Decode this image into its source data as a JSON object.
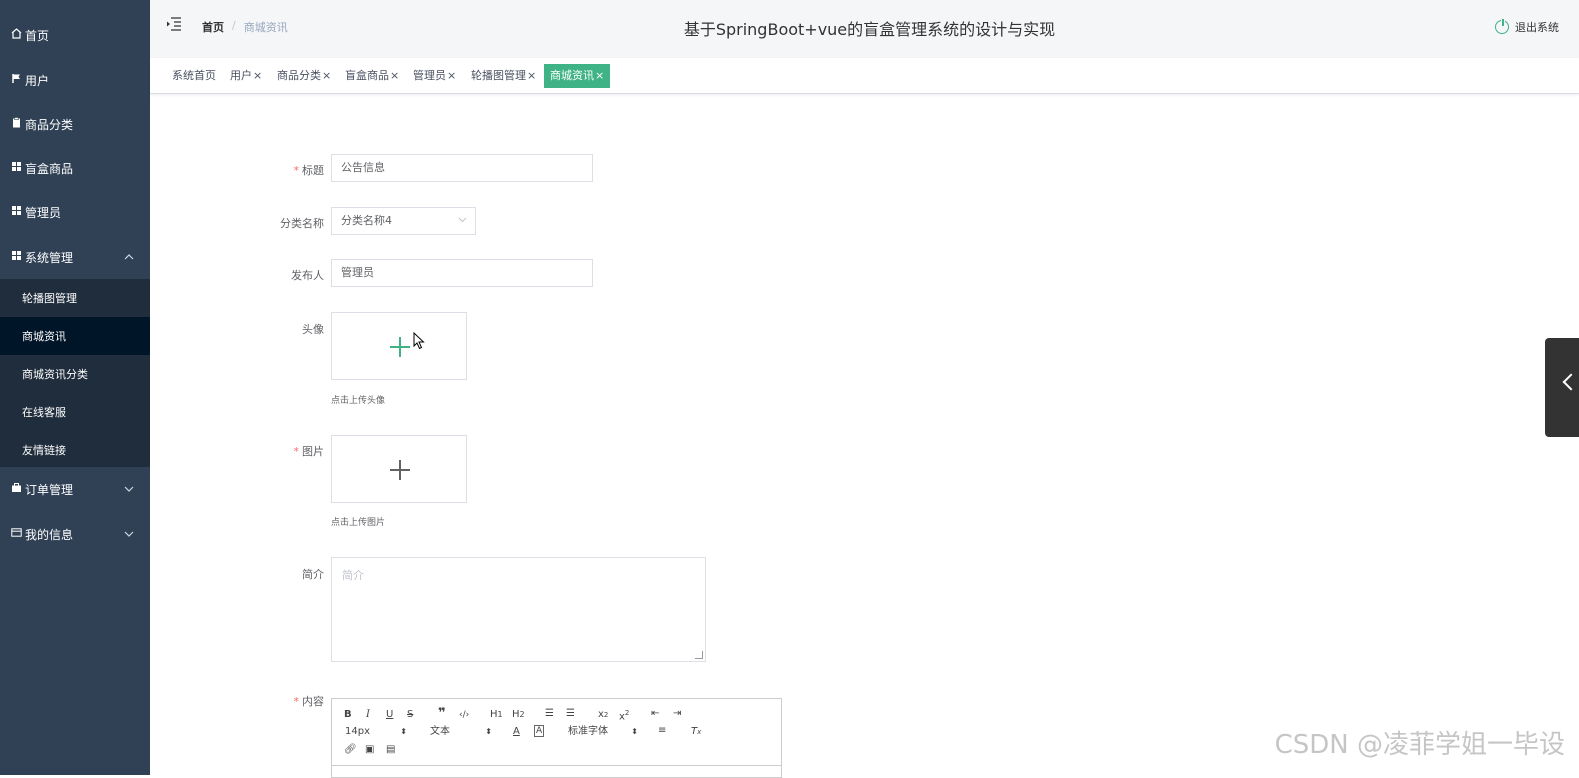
{
  "sidebar": {
    "items": [
      {
        "label": "首页",
        "icon": "home-icon"
      },
      {
        "label": "用户",
        "icon": "flag-icon"
      },
      {
        "label": "商品分类",
        "icon": "clipboard-icon"
      },
      {
        "label": "盲盒商品",
        "icon": "grid-icon"
      },
      {
        "label": "管理员",
        "icon": "grid-icon"
      },
      {
        "label": "系统管理",
        "icon": "grid-icon",
        "expanded": true
      }
    ],
    "sub_items": [
      {
        "label": "轮播图管理"
      },
      {
        "label": "商城资讯",
        "active": true
      },
      {
        "label": "商城资讯分类"
      },
      {
        "label": "在线客服"
      },
      {
        "label": "友情链接"
      }
    ],
    "bottom_items": [
      {
        "label": "订单管理",
        "icon": "briefcase-icon"
      },
      {
        "label": "我的信息",
        "icon": "card-icon"
      }
    ]
  },
  "header": {
    "breadcrumb_home": "首页",
    "breadcrumb_sep": "/",
    "breadcrumb_current": "商城资讯",
    "title": "基于SpringBoot+vue的盲盒管理系统的设计与实现",
    "logout": "退出系统"
  },
  "tags": [
    {
      "label": "系统首页",
      "closable": false
    },
    {
      "label": "用户",
      "closable": true
    },
    {
      "label": "商品分类",
      "closable": true
    },
    {
      "label": "盲盒商品",
      "closable": true
    },
    {
      "label": "管理员",
      "closable": true
    },
    {
      "label": "轮播图管理",
      "closable": true
    },
    {
      "label": "商城资讯",
      "closable": true,
      "active": true
    }
  ],
  "tag_close": "×",
  "form": {
    "title_label": "标题",
    "title_value": "公告信息",
    "category_label": "分类名称",
    "category_value": "分类名称4",
    "publisher_label": "发布人",
    "publisher_value": "管理员",
    "avatar_label": "头像",
    "avatar_hint": "点击上传头像",
    "image_label": "图片",
    "image_hint": "点击上传图片",
    "intro_label": "简介",
    "intro_placeholder": "简介",
    "content_label": "内容",
    "required_mark": "*"
  },
  "editor": {
    "font_size": "14px",
    "header_select": "文本",
    "font_select": "标准字体"
  },
  "watermark": "CSDN @凌菲学姐一毕设",
  "colors": {
    "sidebar": "#304156",
    "accent": "#3fb385",
    "active_sub": "#001528"
  }
}
